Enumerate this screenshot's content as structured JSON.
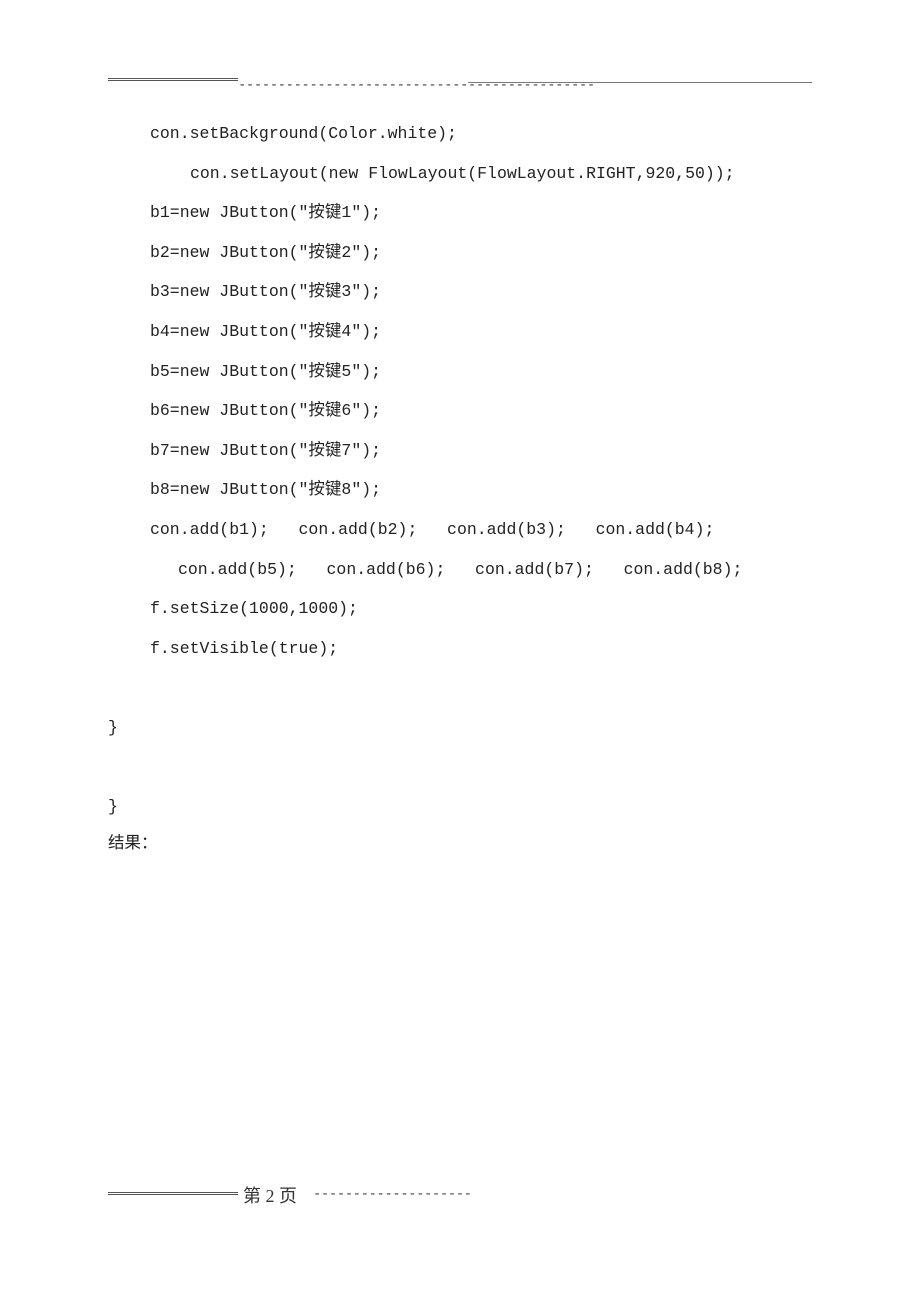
{
  "header": {
    "dashes": "---------------------------------------------"
  },
  "code": {
    "l1": "con.setBackground(Color.white);",
    "l2": "con.setLayout(new FlowLayout(FlowLayout.RIGHT,920,50));",
    "l3": "b1=new JButton(\"按键1\");",
    "l4": "b2=new JButton(\"按键2\");",
    "l5": "b3=new JButton(\"按键3\");",
    "l6": "b4=new JButton(\"按键4\");",
    "l7": "b5=new JButton(\"按键5\");",
    "l8": "b6=new JButton(\"按键6\");",
    "l9": "b7=new JButton(\"按键7\");",
    "l10": "b8=new JButton(\"按键8\");",
    "l11": "con.add(b1);   con.add(b2);   con.add(b3);   con.add(b4);",
    "l12": "con.add(b5);   con.add(b6);   con.add(b7);   con.add(b8);",
    "l13": "f.setSize(1000,1000);",
    "l14": "f.setVisible(true);",
    "blank1": " ",
    "l15": "}",
    "blank2": " ",
    "l16": "}"
  },
  "result_label": "结果：",
  "footer": {
    "page_label": "第 2 页",
    "dashes": "--------------------------------------------"
  }
}
